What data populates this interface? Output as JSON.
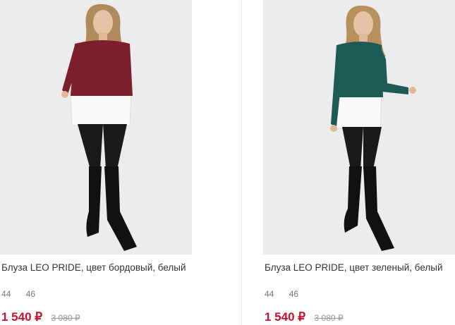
{
  "products": [
    {
      "title": "Блуза LEO PRIDE, цвет бордовый, белый",
      "sizes": [
        "44",
        "46"
      ],
      "price": "1 540 ₽",
      "old_price": "3 080 ₽",
      "sweater_color": "#7a1f2b"
    },
    {
      "title": "Блуза LEO PRIDE, цвет зеленый, белый",
      "sizes": [
        "44",
        "46"
      ],
      "price": "1 540 ₽",
      "old_price": "3 080 ₽",
      "sweater_color": "#1e5a55"
    }
  ],
  "colors": {
    "price": "#c8102e",
    "photo_bg": "#ececec"
  }
}
